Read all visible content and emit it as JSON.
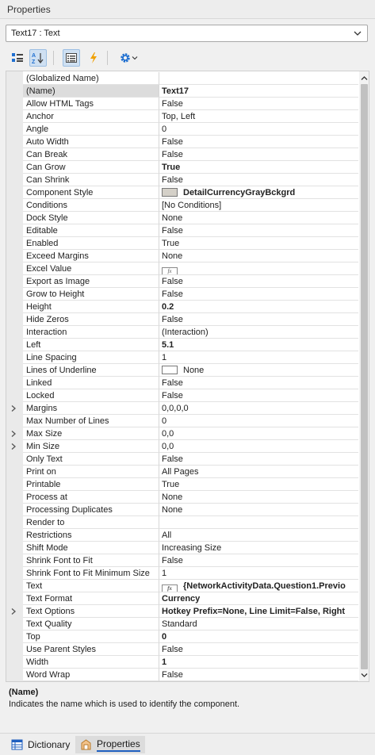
{
  "panel": {
    "title": "Properties"
  },
  "selector": {
    "value": "Text17 : Text"
  },
  "properties": [
    {
      "name": "(Globalized Name)",
      "value": ""
    },
    {
      "name": "(Name)",
      "value": "Text17",
      "bold": true,
      "selected": true
    },
    {
      "name": "Allow HTML Tags",
      "value": "False"
    },
    {
      "name": "Anchor",
      "value": "Top, Left"
    },
    {
      "name": "Angle",
      "value": "0"
    },
    {
      "name": "Auto Width",
      "value": "False"
    },
    {
      "name": "Can Break",
      "value": "False"
    },
    {
      "name": "Can Grow",
      "value": "True",
      "bold": true
    },
    {
      "name": "Can Shrink",
      "value": "False"
    },
    {
      "name": "Component Style",
      "value": "DetailCurrencyGrayBckgrd",
      "bold": true,
      "swatch": "#d4d0c8"
    },
    {
      "name": "Conditions",
      "value": "[No Conditions]"
    },
    {
      "name": "Dock Style",
      "value": "None"
    },
    {
      "name": "Editable",
      "value": "False"
    },
    {
      "name": "Enabled",
      "value": "True"
    },
    {
      "name": "Exceed Margins",
      "value": "None"
    },
    {
      "name": "Excel Value",
      "value": "",
      "fx": true
    },
    {
      "name": "Export as Image",
      "value": "False"
    },
    {
      "name": "Grow to Height",
      "value": "False"
    },
    {
      "name": "Height",
      "value": "0.2",
      "bold": true
    },
    {
      "name": "Hide Zeros",
      "value": "False"
    },
    {
      "name": "Interaction",
      "value": "(Interaction)"
    },
    {
      "name": "Left",
      "value": "5.1",
      "bold": true
    },
    {
      "name": "Line Spacing",
      "value": "1"
    },
    {
      "name": "Lines of Underline",
      "value": "None",
      "swatch": "#ffffff"
    },
    {
      "name": "Linked",
      "value": "False"
    },
    {
      "name": "Locked",
      "value": "False"
    },
    {
      "name": "Margins",
      "value": "0,0,0,0",
      "expandable": true
    },
    {
      "name": "Max Number of Lines",
      "value": "0"
    },
    {
      "name": "Max Size",
      "value": "0,0",
      "expandable": true
    },
    {
      "name": "Min Size",
      "value": "0,0",
      "expandable": true
    },
    {
      "name": "Only Text",
      "value": "False"
    },
    {
      "name": "Print on",
      "value": "All Pages"
    },
    {
      "name": "Printable",
      "value": "True"
    },
    {
      "name": "Process at",
      "value": "None"
    },
    {
      "name": "Processing Duplicates",
      "value": "None"
    },
    {
      "name": "Render to",
      "value": ""
    },
    {
      "name": "Restrictions",
      "value": "All"
    },
    {
      "name": "Shift Mode",
      "value": "Increasing Size"
    },
    {
      "name": "Shrink Font to Fit",
      "value": "False"
    },
    {
      "name": "Shrink Font to Fit Minimum Size",
      "value": "1"
    },
    {
      "name": "Text",
      "value": "{NetworkActivityData.Question1.Previo",
      "bold": true,
      "fx": true
    },
    {
      "name": "Text Format",
      "value": "Currency",
      "bold": true
    },
    {
      "name": "Text Options",
      "value": "Hotkey Prefix=None, Line Limit=False, Right",
      "bold": true,
      "expandable": true
    },
    {
      "name": "Text Quality",
      "value": "Standard"
    },
    {
      "name": "Top",
      "value": "0",
      "bold": true
    },
    {
      "name": "Use Parent Styles",
      "value": "False"
    },
    {
      "name": "Width",
      "value": "1",
      "bold": true
    },
    {
      "name": "Word Wrap",
      "value": "False"
    }
  ],
  "description": {
    "title": "(Name)",
    "text": "Indicates the name which is used to identify the component."
  },
  "tabs": [
    {
      "label": "Dictionary",
      "icon": "dictionary-icon",
      "active": false
    },
    {
      "label": "Properties",
      "icon": "properties-icon",
      "active": true
    }
  ],
  "colors": {
    "accent": "#1f5fbf",
    "lightning": "#f0a000",
    "gear": "#1f6fd0"
  }
}
